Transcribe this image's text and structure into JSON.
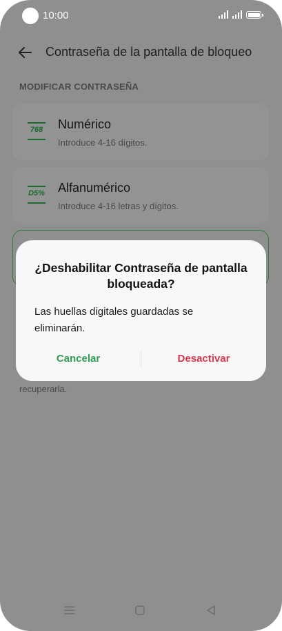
{
  "status_bar": {
    "time": "10:00"
  },
  "header": {
    "title": "Contraseña de la pantalla de bloqueo",
    "back_icon": "arrow-left-icon"
  },
  "section": {
    "label": "MODIFICAR CONTRASEÑA"
  },
  "options": [
    {
      "icon_text": "768",
      "title": "Numérico",
      "subtitle": "Introduce 4-16 dígitos."
    },
    {
      "icon_text": "D5%",
      "title": "Alfanumérico",
      "subtitle": "Introduce 4-16 letras y dígitos."
    }
  ],
  "background_note": "recuperarla.",
  "dialog": {
    "title": "¿Deshabilitar Contraseña de pantalla bloqueada?",
    "message": "Las huellas digitales guardadas se eliminarán.",
    "cancel_label": "Cancelar",
    "confirm_label": "Desactivar"
  },
  "colors": {
    "accent_green": "#2e9e54",
    "danger_red": "#d9354c",
    "scrim": "#8f8f8f",
    "dialog_bg": "#f8f8f8"
  },
  "nav_bar": {
    "icons": [
      "menu-icon",
      "home-icon",
      "back-triangle-icon"
    ]
  }
}
